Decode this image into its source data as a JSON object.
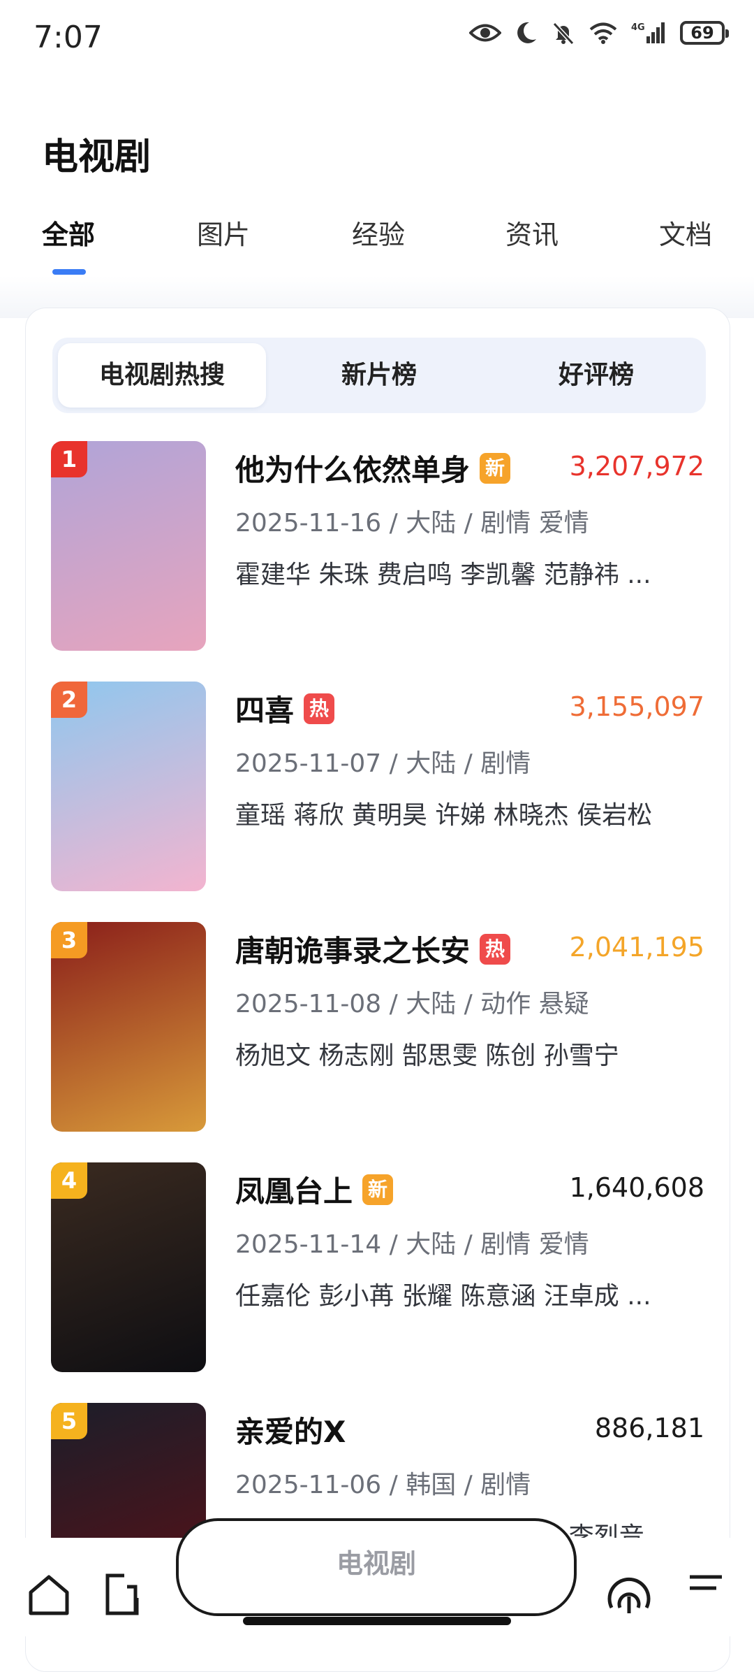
{
  "status": {
    "time": "7:07",
    "battery": "69",
    "network": "4G"
  },
  "page": {
    "title": "电视剧"
  },
  "main_tabs": [
    {
      "label": "全部",
      "active": true
    },
    {
      "label": "图片",
      "active": false
    },
    {
      "label": "经验",
      "active": false
    },
    {
      "label": "资讯",
      "active": false
    },
    {
      "label": "文档",
      "active": false
    }
  ],
  "segments": [
    {
      "label": "电视剧热搜",
      "active": true
    },
    {
      "label": "新片榜",
      "active": false
    },
    {
      "label": "好评榜",
      "active": false
    }
  ],
  "shows": [
    {
      "rank": "1",
      "title": "他为什么依然单身",
      "tag": "新",
      "score": "3,207,972",
      "meta": "2025-11-16 / 大陆 / 剧情 爱情",
      "cast": "霍建华 朱珠 费启鸣 李凯馨 范静祎 ...",
      "rank_color": "#e8332c",
      "tag_color": "#f6a32a",
      "score_color": "#e8332c",
      "poster_top": "#b0a4d8",
      "poster_bottom": "#e7a4bd"
    },
    {
      "rank": "2",
      "title": "四喜",
      "tag": "热",
      "score": "3,155,097",
      "meta": "2025-11-07 / 大陆 / 剧情",
      "cast": "童瑶 蒋欣 黄明昊 许娣 林晓杰 侯岩松",
      "rank_color": "#f0673a",
      "tag_color": "#ef4b4b",
      "score_color": "#ef6c36",
      "poster_top": "#8fc7ee",
      "poster_bottom": "#f3b4cf"
    },
    {
      "rank": "3",
      "title": "唐朝诡事录之长安",
      "tag": "热",
      "score": "2,041,195",
      "meta": "2025-11-08 / 大陆 / 动作 悬疑",
      "cast": "杨旭文 杨志刚 郜思雯 陈创 孙雪宁",
      "rank_color": "#f59b23",
      "tag_color": "#ef4b4b",
      "score_color": "#f4a529",
      "poster_top": "#8a1e1a",
      "poster_bottom": "#d89a3a"
    },
    {
      "rank": "4",
      "title": "凤凰台上",
      "tag": "新",
      "score": "1,640,608",
      "meta": "2025-11-14 / 大陆 / 剧情 爱情",
      "cast": "任嘉伦 彭小苒 张耀 陈意涵 汪卓成 ...",
      "rank_color": "#f5b21e",
      "tag_color": "#f6a32a",
      "score_color": "#1a1a1a",
      "poster_top": "#3a2a20",
      "poster_bottom": "#0e0e12"
    },
    {
      "rank": "5",
      "title": "亲爱的X",
      "tag": "",
      "score": "886,181",
      "meta": "2025-11-06 / 韩国 / 剧情",
      "cast": "金裕贞 金永大 金道勋 黄寅烨 李烈音",
      "rank_color": "#f5b21e",
      "tag_color": "",
      "score_color": "#1a1a1a",
      "poster_top": "#1c1e2a",
      "poster_bottom": "#5a1016"
    }
  ],
  "search_bar": {
    "text": "电视剧"
  }
}
